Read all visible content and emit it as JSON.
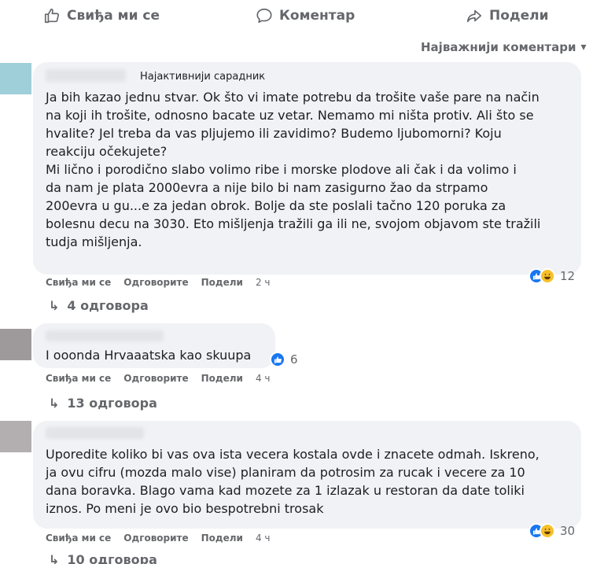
{
  "action_bar": {
    "like_label": "Свиђа ми се",
    "comment_label": "Коментар",
    "share_label": "Подели"
  },
  "sort": {
    "label": "Најважнији коментари",
    "icon": "chevron-down-icon"
  },
  "comments": [
    {
      "badge": "Најактивнији сарадник",
      "text": "Ja bih kazao jednu stvar. Ok što vi imate potrebu da trošite vaše pare na način\nna koji ih trošite, odnosno bacate uz vetar. Nemamo mi ništa protiv. Ali što se\nhvalite? Jel treba da vas pljujemo ili zavidimo? Budemo ljubomorni? Koju\nreakciju očekujete?\nMi lično i porodično slabo volimo ribe i morske plodove ali čak i da volimo i\nda nam je plata 2000evra a nije bilo bi nam zasigurno žao da strpamo\n200evra u gu...e za jedan obrok. Bolje da ste poslali tačno 120 poruka za\nbolesnu decu na 3030. Eto mišljenja tražili ga ili ne, svojom objavom ste tražili\ntudja mišljenja.",
      "like": "Свиђа ми се",
      "reply": "Одговорите",
      "share": "Подели",
      "time": "2 ч",
      "reactions": [
        "like",
        "haha"
      ],
      "reaction_count": "12",
      "replies": "4 одговора"
    },
    {
      "text": "I ooonda Hrvaaatska kao skuupa",
      "like": "Свиђа ми се",
      "reply": "Одговорите",
      "share": "Подели",
      "time": "4 ч",
      "reactions": [
        "like"
      ],
      "reaction_count": "6",
      "replies": "13 одговора"
    },
    {
      "text": "Uporedite koliko bi vas ova ista vecera kostala ovde i znacete odmah. Iskreno,\nja ovu cifru (mozda malo vise) planiram da potrosim za rucak i vecere za 10\ndana boravka. Blago vama kad mozete za 1 izlazak u restoran da date toliki\niznos. Po meni je ovo bio bespotrebni trosak",
      "like": "Свиђа ми се",
      "reply": "Одговорите",
      "share": "Подели",
      "time": "4 ч",
      "reactions": [
        "like",
        "haha"
      ],
      "reaction_count": "30",
      "replies": "10 одговора"
    }
  ],
  "colors": {
    "bubble": "#f0f2f5",
    "secondary_text": "#65676b",
    "like_blue": "#1877f2",
    "haha_yellow": "#f7c02a"
  }
}
